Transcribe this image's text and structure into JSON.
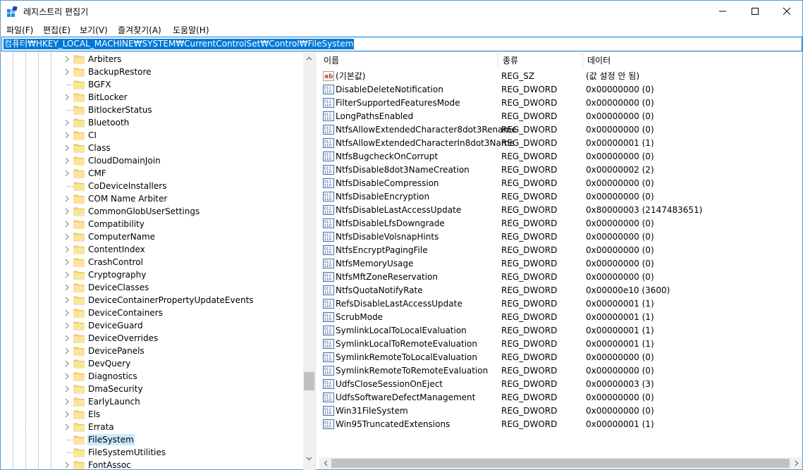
{
  "window": {
    "title": "레지스트리 편집기"
  },
  "menu": [
    {
      "label": "파일(F)"
    },
    {
      "label": "편집(E)"
    },
    {
      "label": "보기(V)"
    },
    {
      "label": "즐겨찾기(A)"
    },
    {
      "label": "도움말(H)"
    }
  ],
  "address": {
    "value": "컴퓨터₩HKEY_LOCAL_MACHINE₩SYSTEM₩CurrentControlSet₩Control₩FileSystem"
  },
  "tree": {
    "items": [
      {
        "label": "Arbiters",
        "expandable": true
      },
      {
        "label": "BackupRestore",
        "expandable": true
      },
      {
        "label": "BGFX",
        "expandable": false
      },
      {
        "label": "BitLocker",
        "expandable": true
      },
      {
        "label": "BitlockerStatus",
        "expandable": false
      },
      {
        "label": "Bluetooth",
        "expandable": true
      },
      {
        "label": "CI",
        "expandable": true
      },
      {
        "label": "Class",
        "expandable": true
      },
      {
        "label": "CloudDomainJoin",
        "expandable": true
      },
      {
        "label": "CMF",
        "expandable": true
      },
      {
        "label": "CoDeviceInstallers",
        "expandable": false
      },
      {
        "label": "COM Name Arbiter",
        "expandable": true
      },
      {
        "label": "CommonGlobUserSettings",
        "expandable": true
      },
      {
        "label": "Compatibility",
        "expandable": true
      },
      {
        "label": "ComputerName",
        "expandable": true
      },
      {
        "label": "ContentIndex",
        "expandable": true
      },
      {
        "label": "CrashControl",
        "expandable": true
      },
      {
        "label": "Cryptography",
        "expandable": true
      },
      {
        "label": "DeviceClasses",
        "expandable": true
      },
      {
        "label": "DeviceContainerPropertyUpdateEvents",
        "expandable": true
      },
      {
        "label": "DeviceContainers",
        "expandable": true
      },
      {
        "label": "DeviceGuard",
        "expandable": true
      },
      {
        "label": "DeviceOverrides",
        "expandable": true
      },
      {
        "label": "DevicePanels",
        "expandable": true
      },
      {
        "label": "DevQuery",
        "expandable": true
      },
      {
        "label": "Diagnostics",
        "expandable": true
      },
      {
        "label": "DmaSecurity",
        "expandable": true
      },
      {
        "label": "EarlyLaunch",
        "expandable": true
      },
      {
        "label": "Els",
        "expandable": true
      },
      {
        "label": "Errata",
        "expandable": true
      },
      {
        "label": "FileSystem",
        "expandable": false,
        "selected": true
      },
      {
        "label": "FileSystemUtilities",
        "expandable": false
      },
      {
        "label": "FontAssoc",
        "expandable": true
      }
    ]
  },
  "columns": {
    "name": "이름",
    "type": "종류",
    "data": "데이터"
  },
  "values": [
    {
      "name": "(기본값)",
      "type": "REG_SZ",
      "data": "(값 설정 안 됨)",
      "icon": "string-value-icon"
    },
    {
      "name": "DisableDeleteNotification",
      "type": "REG_DWORD",
      "data": "0x00000000 (0)",
      "icon": "binary-value-icon"
    },
    {
      "name": "FilterSupportedFeaturesMode",
      "type": "REG_DWORD",
      "data": "0x00000000 (0)",
      "icon": "binary-value-icon"
    },
    {
      "name": "LongPathsEnabled",
      "type": "REG_DWORD",
      "data": "0x00000000 (0)",
      "icon": "binary-value-icon"
    },
    {
      "name": "NtfsAllowExtendedCharacter8dot3Rename",
      "type": "REG_DWORD",
      "data": "0x00000000 (0)",
      "icon": "binary-value-icon"
    },
    {
      "name": "NtfsAllowExtendedCharacterIn8dot3Name",
      "type": "REG_DWORD",
      "data": "0x00000001 (1)",
      "icon": "binary-value-icon"
    },
    {
      "name": "NtfsBugcheckOnCorrupt",
      "type": "REG_DWORD",
      "data": "0x00000000 (0)",
      "icon": "binary-value-icon"
    },
    {
      "name": "NtfsDisable8dot3NameCreation",
      "type": "REG_DWORD",
      "data": "0x00000002 (2)",
      "icon": "binary-value-icon"
    },
    {
      "name": "NtfsDisableCompression",
      "type": "REG_DWORD",
      "data": "0x00000000 (0)",
      "icon": "binary-value-icon"
    },
    {
      "name": "NtfsDisableEncryption",
      "type": "REG_DWORD",
      "data": "0x00000000 (0)",
      "icon": "binary-value-icon"
    },
    {
      "name": "NtfsDisableLastAccessUpdate",
      "type": "REG_DWORD",
      "data": "0x80000003 (2147483651)",
      "icon": "binary-value-icon"
    },
    {
      "name": "NtfsDisableLfsDowngrade",
      "type": "REG_DWORD",
      "data": "0x00000000 (0)",
      "icon": "binary-value-icon"
    },
    {
      "name": "NtfsDisableVolsnapHints",
      "type": "REG_DWORD",
      "data": "0x00000000 (0)",
      "icon": "binary-value-icon"
    },
    {
      "name": "NtfsEncryptPagingFile",
      "type": "REG_DWORD",
      "data": "0x00000000 (0)",
      "icon": "binary-value-icon"
    },
    {
      "name": "NtfsMemoryUsage",
      "type": "REG_DWORD",
      "data": "0x00000000 (0)",
      "icon": "binary-value-icon"
    },
    {
      "name": "NtfsMftZoneReservation",
      "type": "REG_DWORD",
      "data": "0x00000000 (0)",
      "icon": "binary-value-icon"
    },
    {
      "name": "NtfsQuotaNotifyRate",
      "type": "REG_DWORD",
      "data": "0x00000e10 (3600)",
      "icon": "binary-value-icon"
    },
    {
      "name": "RefsDisableLastAccessUpdate",
      "type": "REG_DWORD",
      "data": "0x00000001 (1)",
      "icon": "binary-value-icon"
    },
    {
      "name": "ScrubMode",
      "type": "REG_DWORD",
      "data": "0x00000001 (1)",
      "icon": "binary-value-icon"
    },
    {
      "name": "SymlinkLocalToLocalEvaluation",
      "type": "REG_DWORD",
      "data": "0x00000001 (1)",
      "icon": "binary-value-icon"
    },
    {
      "name": "SymlinkLocalToRemoteEvaluation",
      "type": "REG_DWORD",
      "data": "0x00000001 (1)",
      "icon": "binary-value-icon"
    },
    {
      "name": "SymlinkRemoteToLocalEvaluation",
      "type": "REG_DWORD",
      "data": "0x00000000 (0)",
      "icon": "binary-value-icon"
    },
    {
      "name": "SymlinkRemoteToRemoteEvaluation",
      "type": "REG_DWORD",
      "data": "0x00000000 (0)",
      "icon": "binary-value-icon"
    },
    {
      "name": "UdfsCloseSessionOnEject",
      "type": "REG_DWORD",
      "data": "0x00000003 (3)",
      "icon": "binary-value-icon"
    },
    {
      "name": "UdfsSoftwareDefectManagement",
      "type": "REG_DWORD",
      "data": "0x00000000 (0)",
      "icon": "binary-value-icon"
    },
    {
      "name": "Win31FileSystem",
      "type": "REG_DWORD",
      "data": "0x00000000 (0)",
      "icon": "binary-value-icon"
    },
    {
      "name": "Win95TruncatedExtensions",
      "type": "REG_DWORD",
      "data": "0x00000001 (1)",
      "icon": "binary-value-icon"
    }
  ]
}
